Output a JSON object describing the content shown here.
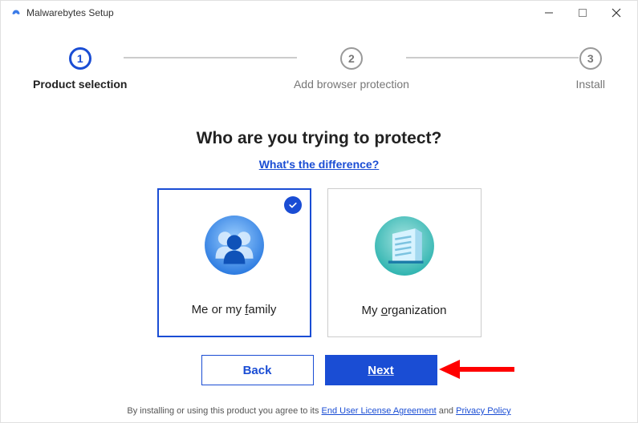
{
  "titlebar": {
    "title": "Malwarebytes Setup"
  },
  "stepper": {
    "steps": [
      {
        "num": "1",
        "label": "Product selection"
      },
      {
        "num": "2",
        "label": "Add browser protection"
      },
      {
        "num": "3",
        "label": "Install"
      }
    ]
  },
  "heading": "Who are you trying to protect?",
  "difference_link": "What's the difference?",
  "options": {
    "family": {
      "label": "Me or my family"
    },
    "organization": {
      "label": "My organization"
    }
  },
  "buttons": {
    "back": "Back",
    "next": "Next"
  },
  "footer": {
    "prefix": "By installing or using this product you agree to its ",
    "eula": "End User License Agreement",
    "mid": " and ",
    "privacy": "Privacy Policy"
  }
}
